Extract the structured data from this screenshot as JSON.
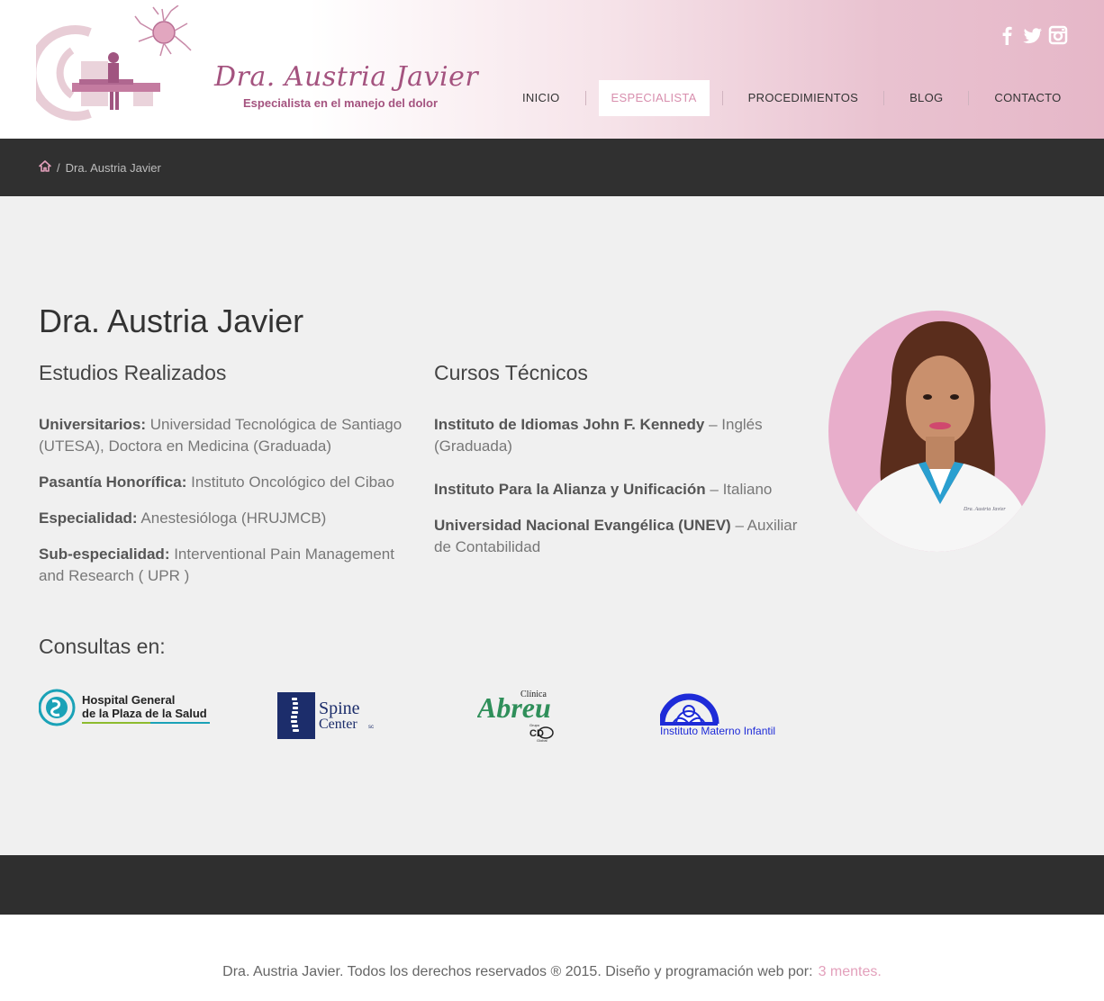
{
  "header": {
    "logo_title": "Dra. Austria Javier",
    "logo_subtitle": "Especialista en el manejo del dolor",
    "social": [
      "facebook-icon",
      "twitter-icon",
      "instagram-icon"
    ],
    "nav": {
      "inicio": "INICIO",
      "especialista": "ESPECIALISTA",
      "procedimientos": "PROCEDIMIENTOS",
      "blog": "BLOG",
      "contacto": "CONTACTO"
    }
  },
  "breadcrumb": {
    "separator": "/",
    "current": "Dra. Austria Javier"
  },
  "main": {
    "title": "Dra. Austria Javier",
    "studies": {
      "heading": "Estudios Realizados",
      "items": [
        {
          "label": "Universitarios:",
          "text": " Universidad Tecnológica de Santiago (UTESA), Doctora en Medicina (Graduada)"
        },
        {
          "label": "Pasantía Honorífica:",
          "text": " Instituto Oncológico del Cibao"
        },
        {
          "label": "Especialidad:",
          "text": " Anestesióloga (HRUJMCB)"
        },
        {
          "label": "Sub-especialidad:",
          "text": " Interventional Pain Management and Research ( UPR )"
        }
      ]
    },
    "courses": {
      "heading": "Cursos Técnicos",
      "items": [
        {
          "label": "Instituto de Idiomas John F. Kennedy",
          "text": " – Inglés (Graduada)"
        },
        {
          "label": "Instituto Para la Alianza y Unificación",
          "text": " – Italiano"
        },
        {
          "label": "Universidad Nacional Evangélica (UNEV)",
          "text": " – Auxiliar de Contabilidad"
        }
      ]
    },
    "consultas": {
      "heading": "Consultas en:",
      "hospital_line1": "Hospital General",
      "hospital_line2": "de la Plaza de la Salud",
      "spine_line1": "Spine",
      "spine_line2": "Center",
      "spine_sup": "sc",
      "abreu_small": "Clínica",
      "abreu_big": "Abreu",
      "abreu_grupo": "Grupo",
      "abreu_cd": "CD",
      "abreu_global": "Global",
      "materno": "Instituto Materno Infantil",
      "photo_caption": "Dra. Austria Javier"
    }
  },
  "footer": {
    "text": "Dra. Austria Javier. Todos los derechos reservados ® 2015. Diseño y programación web por:",
    "link": "3 mentes."
  },
  "colors": {
    "accent": "#e3a0bb",
    "brand": "#a4537f",
    "dark": "#303030"
  }
}
